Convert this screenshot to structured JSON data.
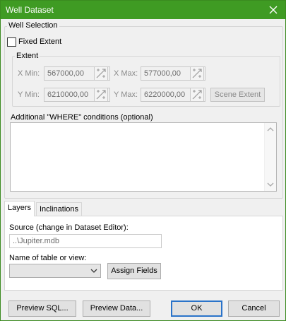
{
  "window": {
    "title": "Well Dataset"
  },
  "well_selection": {
    "legend": "Well Selection",
    "fixed_extent_label": "Fixed Extent",
    "fixed_extent_checked": false,
    "extent": {
      "legend": "Extent",
      "xmin_label": "X Min:",
      "xmin_value": "567000,00",
      "xmax_label": "X Max:",
      "xmax_value": "577000,00",
      "ymin_label": "Y Min:",
      "ymin_value": "6210000,00",
      "ymax_label": "Y Max:",
      "ymax_value": "6220000,00",
      "scene_extent_label": "Scene Extent"
    },
    "where_label": "Additional \"WHERE\" conditions (optional)",
    "where_value": ""
  },
  "tabs": [
    {
      "label": "Layers",
      "active": true
    },
    {
      "label": "Inclinations",
      "active": false
    }
  ],
  "layers": {
    "source_label": "Source (change in Dataset Editor):",
    "source_value": "..\\Jupiter.mdb",
    "table_label": "Name of table or view:",
    "table_value": "",
    "assign_fields_label": "Assign Fields"
  },
  "footer": {
    "preview_sql_label": "Preview SQL...",
    "preview_data_label": "Preview Data...",
    "ok_label": "OK",
    "cancel_label": "Cancel"
  },
  "colors": {
    "titlebar": "#3f9b23",
    "default_button_border": "#2a73c9"
  },
  "icons": {
    "close": "close-icon",
    "pick_coordinate": "pick-coordinate-icon",
    "dropdown": "chevron-down-icon",
    "scroll_up": "scroll-up-arrow-icon",
    "scroll_down": "scroll-down-arrow-icon"
  }
}
